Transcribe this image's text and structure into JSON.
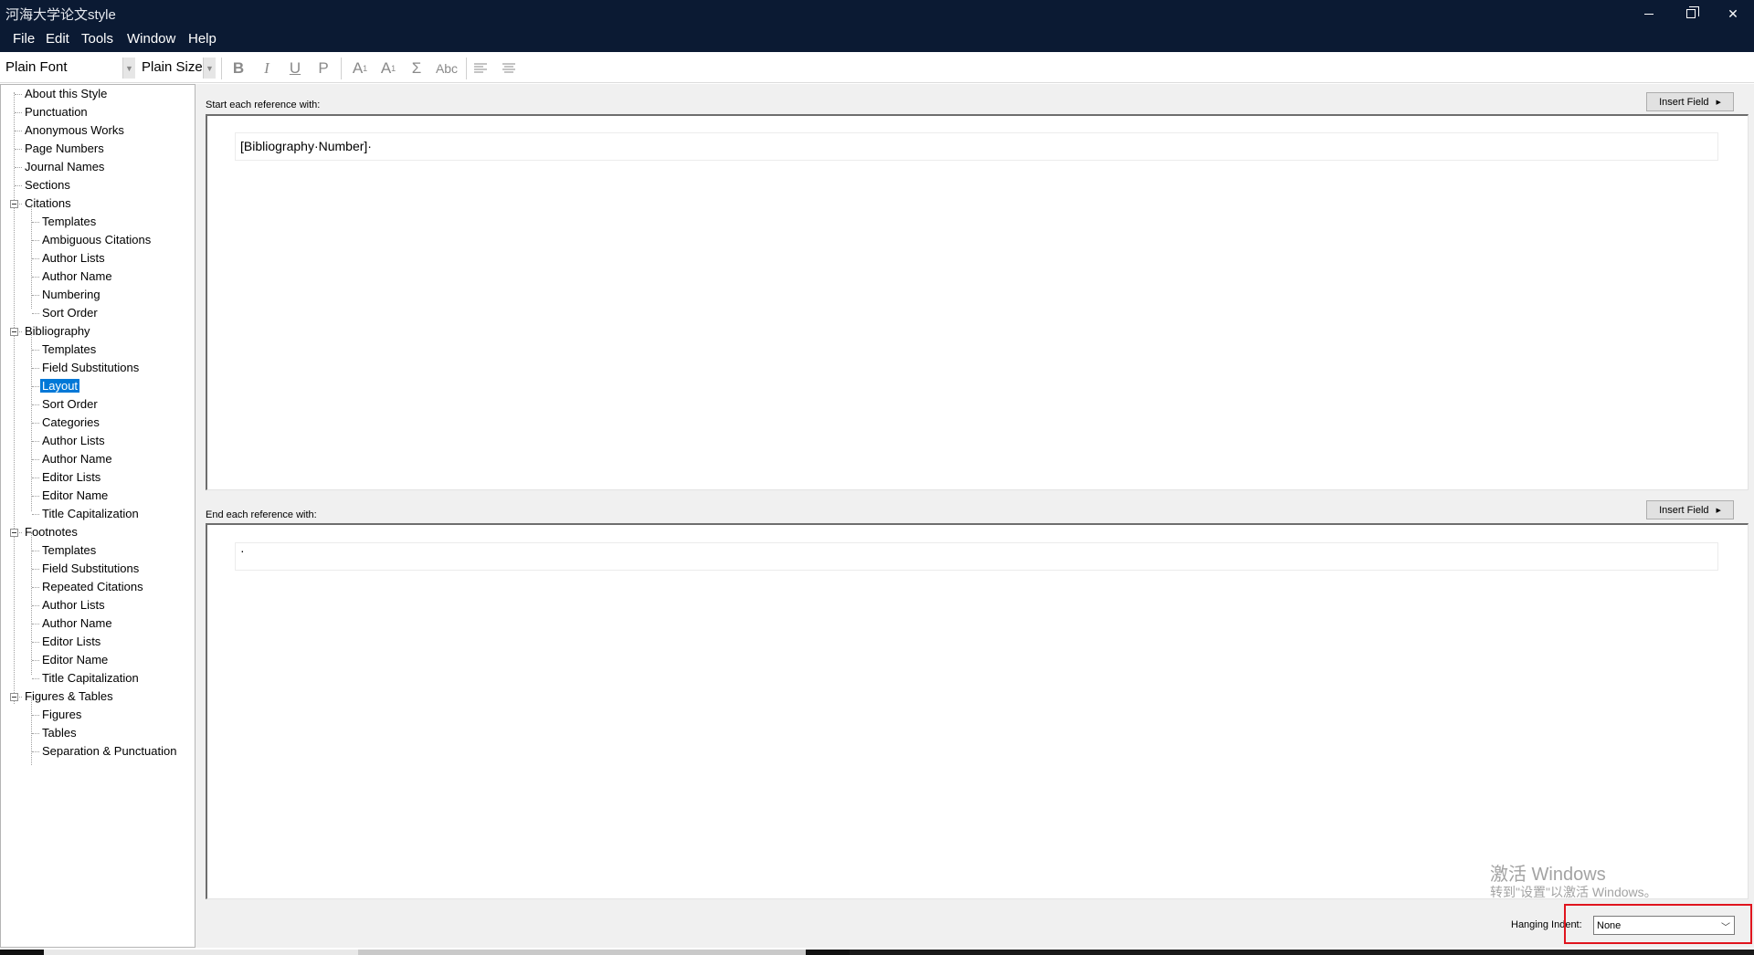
{
  "window": {
    "title": "河海大学论文style"
  },
  "menu": [
    "File",
    "Edit",
    "Tools",
    "Window",
    "Help"
  ],
  "toolbar": {
    "font": "Plain Font",
    "size": "Plain Size",
    "buttons": {
      "bold": "B",
      "italic": "I",
      "underline": "U",
      "plain": "P",
      "superscript": "A",
      "superscript_mark": "1",
      "subscript": "A",
      "subscript_mark": "1",
      "symbol": "Σ",
      "smallcaps": "Abc"
    }
  },
  "tree": [
    "About this Style",
    "Punctuation",
    "Anonymous Works",
    "Page Numbers",
    "Journal Names",
    "Sections",
    "Citations",
    "Templates",
    "Ambiguous Citations",
    "Author Lists",
    "Author Name",
    "Numbering",
    "Sort Order",
    "Bibliography",
    "Templates",
    "Field Substitutions",
    "Layout",
    "Sort Order",
    "Categories",
    "Author Lists",
    "Author Name",
    "Editor Lists",
    "Editor Name",
    "Title Capitalization",
    "Footnotes",
    "Templates",
    "Field Substitutions",
    "Repeated Citations",
    "Author Lists",
    "Author Name",
    "Editor Lists",
    "Editor Name",
    "Title Capitalization",
    "Figures & Tables",
    "Figures",
    "Tables",
    "Separation & Punctuation"
  ],
  "layout": {
    "start_label": "Start each reference with:",
    "start_value": "[Bibliography·Number]·",
    "end_label": "End each reference with:",
    "end_value": "·",
    "insert_field": "Insert Field",
    "hanging_indent_label": "Hanging Indent:",
    "hanging_indent_value": "None"
  },
  "watermark": {
    "line1": "激活 Windows",
    "line2": "转到\"设置\"以激活 Windows。"
  },
  "colors": {
    "titlebar": "#0b1a33",
    "selection": "#0078d7",
    "highlight": "#e0151e"
  }
}
